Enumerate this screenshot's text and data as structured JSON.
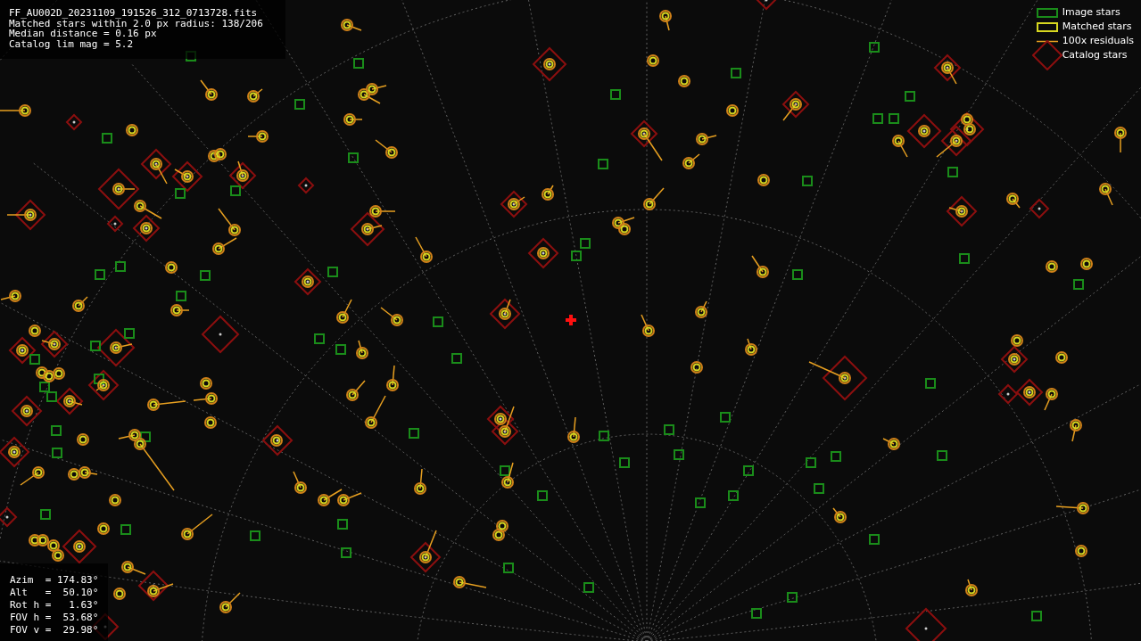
{
  "header": {
    "lines": [
      "FF_AU002D_20231109_191526_312_0713728.fits",
      "Matched stars within 2.0 px radius: 138/206",
      "Median distance = 0.16 px",
      "Catalog lim mag = 5.2"
    ]
  },
  "legend": [
    {
      "kind": "image",
      "label": "Image stars"
    },
    {
      "kind": "matched",
      "label": "Matched stars"
    },
    {
      "kind": "residual",
      "label": "100x residuals"
    },
    {
      "kind": "catalog",
      "label": "Catalog stars"
    }
  ],
  "pointing": {
    "lines": [
      "Azim  = 174.83°",
      "Alt   =  50.10°",
      "Rot h =   1.63°",
      "FOV h =  53.68°",
      "FOV v =  29.98°"
    ]
  }
}
